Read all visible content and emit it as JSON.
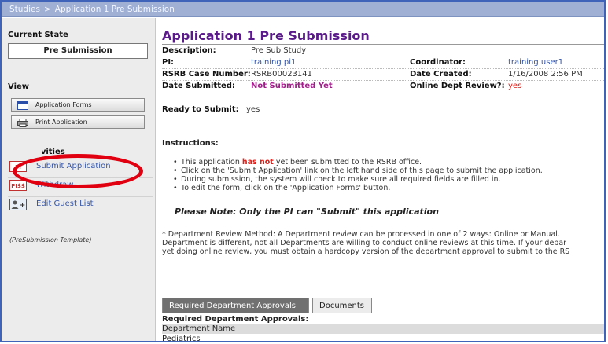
{
  "breadcrumb": {
    "root": "Studies",
    "separator": ">",
    "current": "Application 1 Pre Submission"
  },
  "sidebar": {
    "current_state_heading": "Current State",
    "current_state": "Pre Submission",
    "view_heading": "View",
    "view_buttons": [
      {
        "label": "Application Forms",
        "icon": "window-icon"
      },
      {
        "label": "Print Application",
        "icon": "printer-icon"
      }
    ],
    "activities_heading": "My Activities",
    "activities": [
      {
        "label": "Submit Application",
        "icon": "pi-icon"
      },
      {
        "label": "Withdraw",
        "icon": "pi-badge-icon"
      },
      {
        "label": "Edit Guest List",
        "icon": "add-user-icon"
      }
    ],
    "template_note": "(PreSubmission Template)"
  },
  "main": {
    "title": "Application 1 Pre Submission",
    "fields": {
      "description_label": "Description:",
      "description_value": "Pre Sub Study",
      "pi_label": "PI:",
      "pi_value": "training pi1",
      "coordinator_label": "Coordinator:",
      "coordinator_value": "training user1",
      "case_label": "RSRB Case Number:",
      "case_value": "RSRB00023141",
      "created_label": "Date Created:",
      "created_value": "1/16/2008 2:56 PM",
      "submitted_label": "Date Submitted:",
      "submitted_value": "Not Submitted Yet",
      "online_label": "Online Dept Review?:",
      "online_value": "yes",
      "ready_label": "Ready to Submit:",
      "ready_value": "yes"
    },
    "instructions_title": "Instructions:",
    "instructions": {
      "i1_pre": "This application ",
      "i1_em": "has not",
      "i1_post": " yet been submitted to the RSRB office.",
      "i2": "Click on the 'Submit Application' link on the left hand side of this page to submit the application.",
      "i3": "During submission, the system will check to make sure all required fields are filled in.",
      "i4": "To edit the form, click on the 'Application Forms' button."
    },
    "note": "Please Note: Only the PI can \"Submit\" this application",
    "dept_review": {
      "line1": "* Department Review Method:  A Department review can be processed in one of 2 ways: Online or Manual.",
      "line2": "Department is different, not all Departments are willing to conduct online reviews at this time. If your depar",
      "line3": "yet doing online review, you must obtain a hardcopy version of the department approval to submit to the RS"
    },
    "tabs": [
      {
        "label": "Required Department Approvals"
      },
      {
        "label": "Documents"
      }
    ],
    "required_label": "Required Department Approvals:",
    "table": {
      "header": "Department Name",
      "rows": [
        "Pediatrics"
      ]
    }
  },
  "colors": {
    "accent": "#3f63b8",
    "title": "#5a1a8a",
    "highlight": "#e0000f"
  }
}
